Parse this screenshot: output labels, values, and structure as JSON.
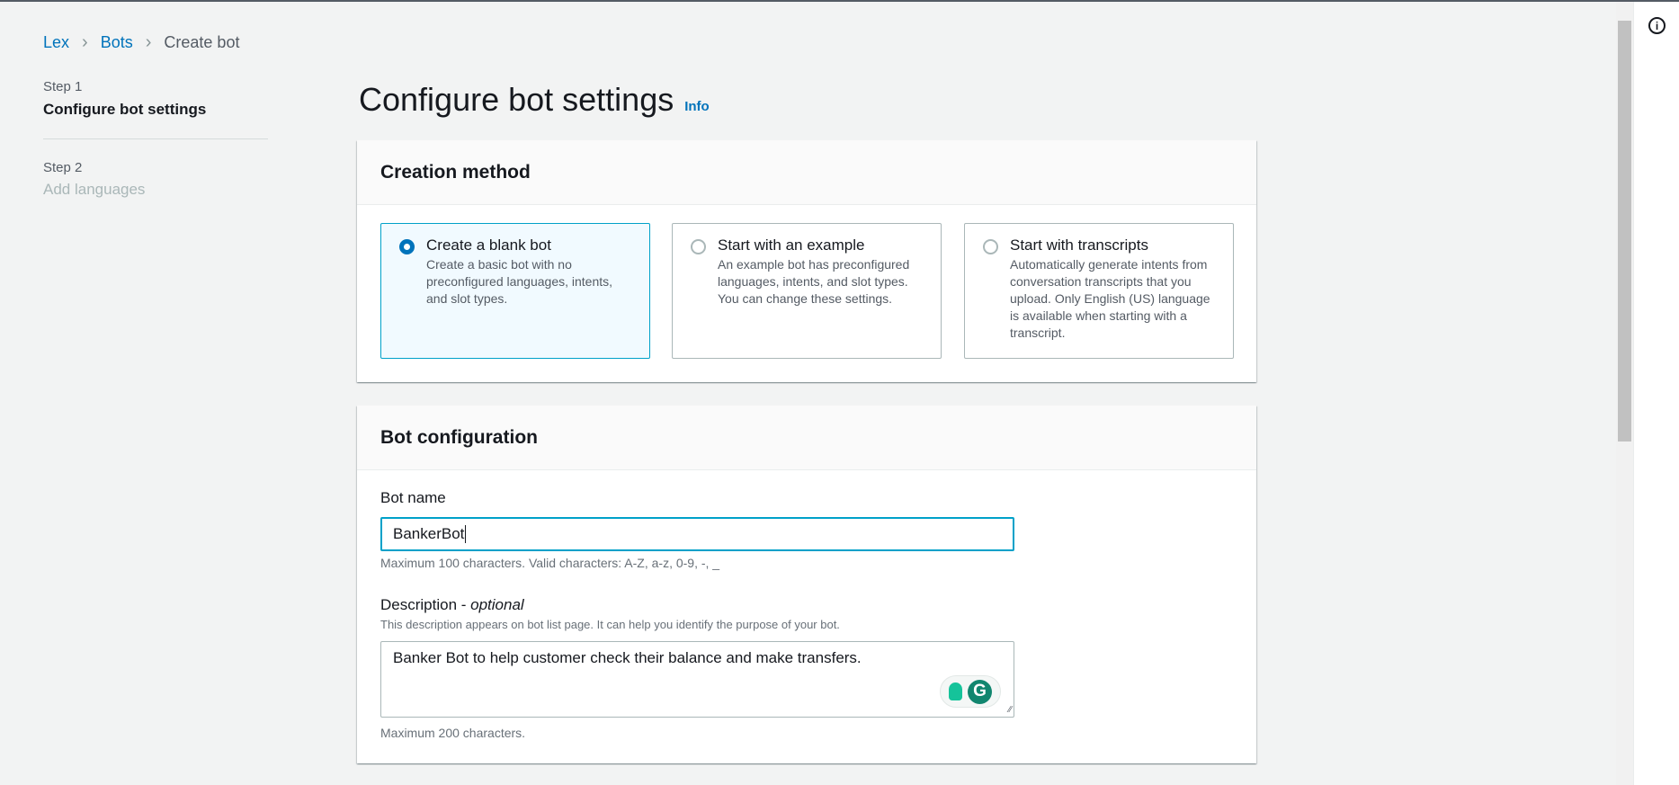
{
  "breadcrumb": {
    "items": [
      "Lex",
      "Bots"
    ],
    "current": "Create bot"
  },
  "steps": [
    {
      "label": "Step 1",
      "title": "Configure bot settings"
    },
    {
      "label": "Step 2",
      "title": "Add languages"
    }
  ],
  "page": {
    "title": "Configure bot settings",
    "info": "Info"
  },
  "creation": {
    "heading": "Creation method",
    "options": [
      {
        "title": "Create a blank bot",
        "desc": "Create a basic bot with no preconfigured languages, intents, and slot types.",
        "selected": true
      },
      {
        "title": "Start with an example",
        "desc": "An example bot has preconfigured languages, intents, and slot types. You can change these settings.",
        "selected": false
      },
      {
        "title": "Start with transcripts",
        "desc": "Automatically generate intents from conversation transcripts that you upload. Only English (US) language is available when starting with a transcript.",
        "selected": false
      }
    ]
  },
  "config": {
    "heading": "Bot configuration",
    "name_label": "Bot name",
    "name_value": "BankerBot",
    "name_hint": "Maximum 100 characters. Valid characters: A-Z, a-z, 0-9, -, _",
    "desc_label": "Description - ",
    "desc_optional": "optional",
    "desc_sub": "This description appears on bot list page. It can help you identify the purpose of your bot.",
    "desc_value": "Banker Bot to help customer check their balance and make transfers.",
    "desc_hint": "Maximum 200 characters.",
    "grammarly": "G"
  },
  "side": {
    "info_icon": "i"
  }
}
